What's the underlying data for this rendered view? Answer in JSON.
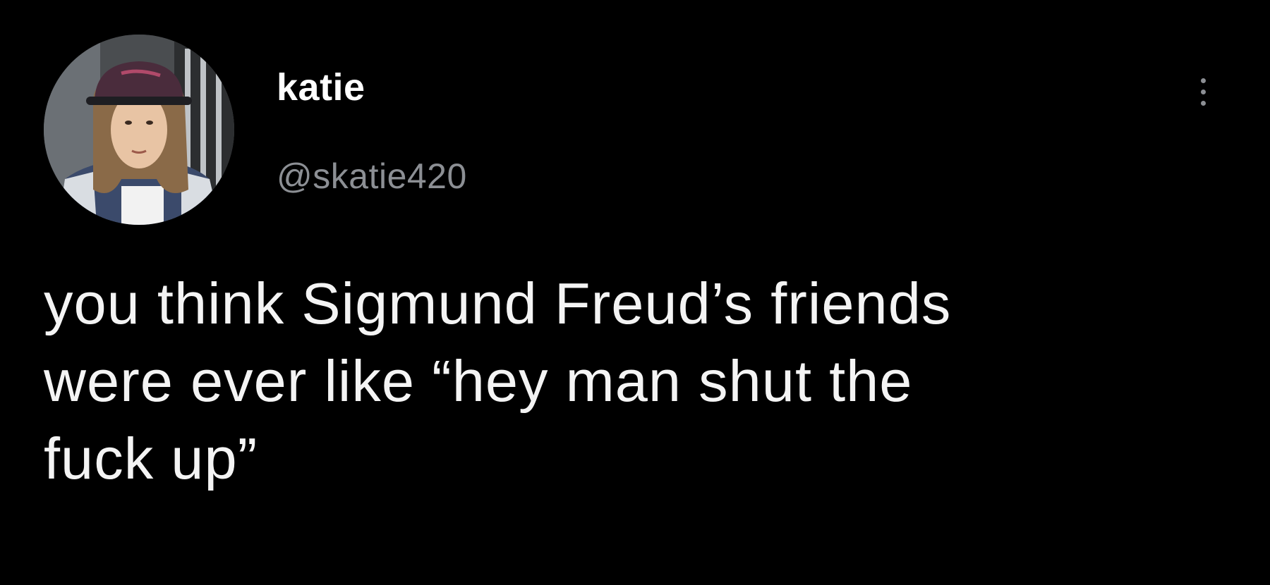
{
  "tweet": {
    "display_name": "katie",
    "handle": "@skatie420",
    "text_lines": [
      "you think Sigmund Freud’s friends",
      "were ever like “hey man shut the",
      "fuck up”"
    ],
    "avatar_icon": "user-avatar-photo",
    "more_icon": "more-vertical-icon"
  },
  "colors": {
    "background": "#000000",
    "primary_text": "#ffffff",
    "secondary_text": "#8c8f94"
  }
}
